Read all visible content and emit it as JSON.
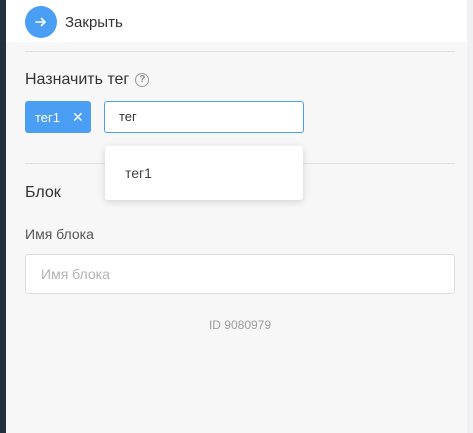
{
  "header": {
    "close_label": "Закрыть"
  },
  "tags_section": {
    "title": "Назначить тег",
    "help_icon": "question-circle-icon",
    "selected_tags": [
      {
        "label": "тег1"
      }
    ],
    "input_value": "тег",
    "suggestions": [
      {
        "label": "тег1"
      }
    ]
  },
  "block_section": {
    "title": "Блок",
    "name_label": "Имя блока",
    "name_placeholder": "Имя блока",
    "name_value": "",
    "id_text": "ID 9080979"
  },
  "colors": {
    "accent": "#4a9ff5",
    "sidebar": "#23313f"
  }
}
